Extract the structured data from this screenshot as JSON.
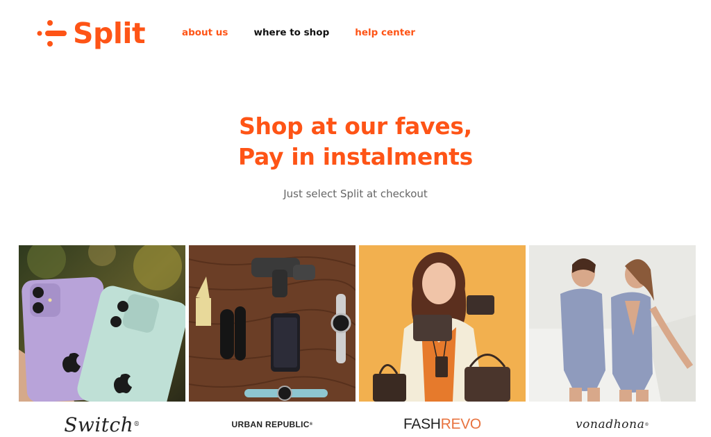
{
  "brand": {
    "name": "Split",
    "color": "#fe5416",
    "logo_icon": "split-dots-mark"
  },
  "nav": {
    "about": "about us",
    "where": "where to shop",
    "help": "help center"
  },
  "hero": {
    "title_line1": "Shop at our faves,",
    "title_line2": "Pay in instalments",
    "subtitle": "Just select Split at checkout"
  },
  "merchants": [
    {
      "brand": "Switch",
      "mark": "®",
      "photo": "purple and mint iPhones held in hand"
    },
    {
      "brand": "URBAN REPUBLIC",
      "mark": "®",
      "photo": "gadgets laid out on wooden table"
    },
    {
      "brand_main": "FASH",
      "brand_tail": "REVO",
      "photo": "woman holding wallet and handbags on yellow background"
    },
    {
      "brand": "vonadhona",
      "mark": "®",
      "photo": "two women in patterned swimsuits"
    }
  ]
}
